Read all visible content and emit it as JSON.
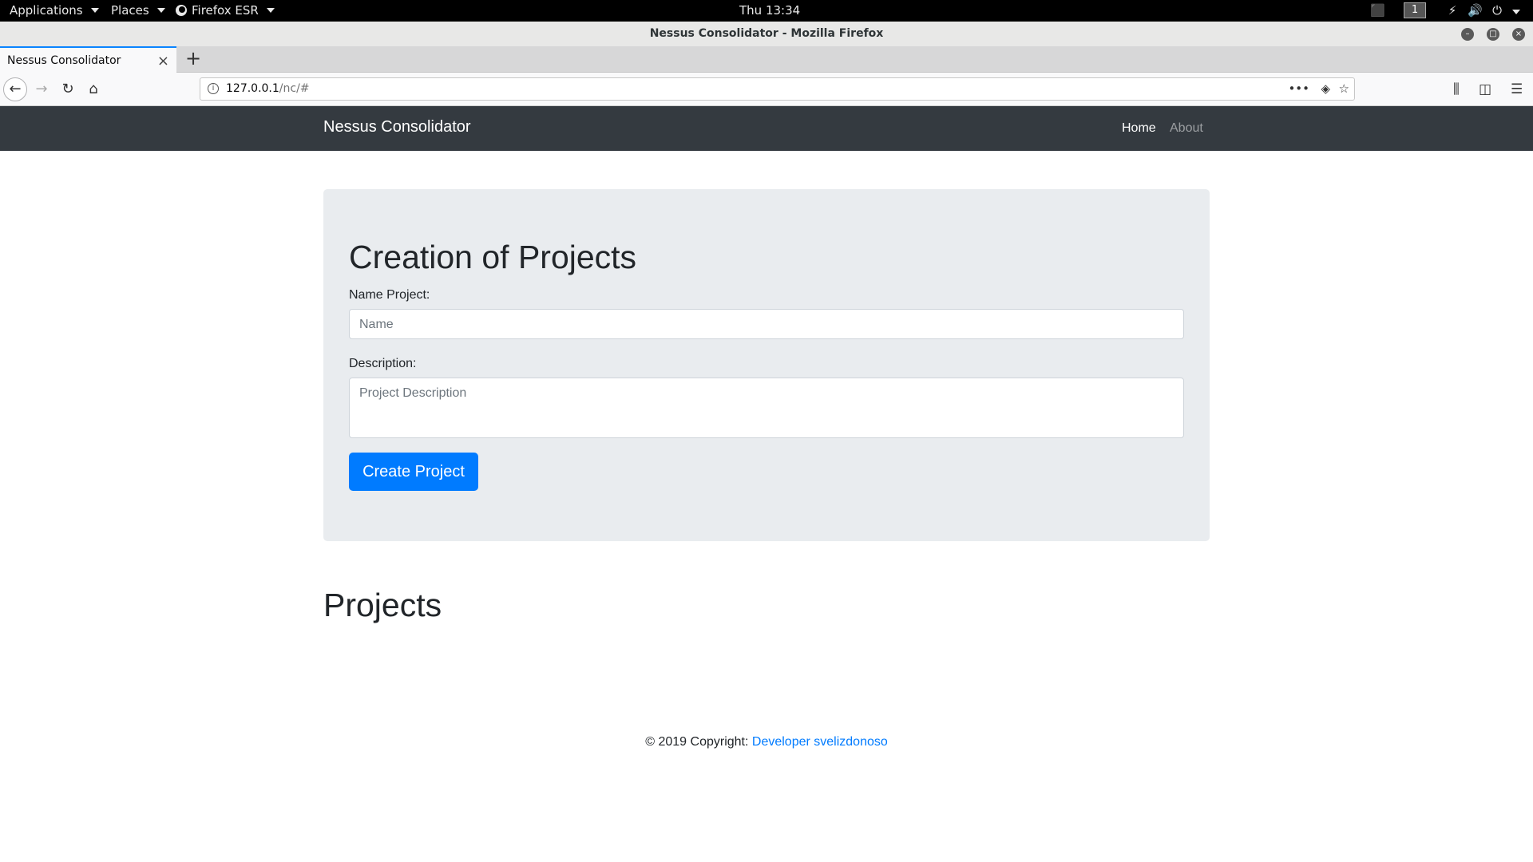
{
  "topbar": {
    "applications": "Applications",
    "places": "Places",
    "browser": "Firefox ESR",
    "clock": "Thu 13:34",
    "workspace": "1"
  },
  "window": {
    "title": "Nessus Consolidator - Mozilla Firefox"
  },
  "tab": {
    "title": "Nessus Consolidator",
    "close": "×",
    "new": "+"
  },
  "urlbar": {
    "host": "127.0.0.1",
    "path": "/nc/#"
  },
  "app": {
    "brand": "Nessus Consolidator",
    "nav": {
      "home": "Home",
      "about": "About"
    },
    "form": {
      "heading": "Creation of Projects",
      "name_label": "Name Project:",
      "name_placeholder": "Name",
      "desc_label": "Description:",
      "desc_placeholder": "Project Description",
      "submit": "Create Project"
    },
    "projects_heading": "Projects",
    "footer": {
      "copyright": "© 2019 Copyright:",
      "link": "Developer svelizdonoso"
    }
  },
  "colors": {
    "navbar": "#343a40",
    "jumbotron": "#e9ecef",
    "primary": "#007bff"
  }
}
